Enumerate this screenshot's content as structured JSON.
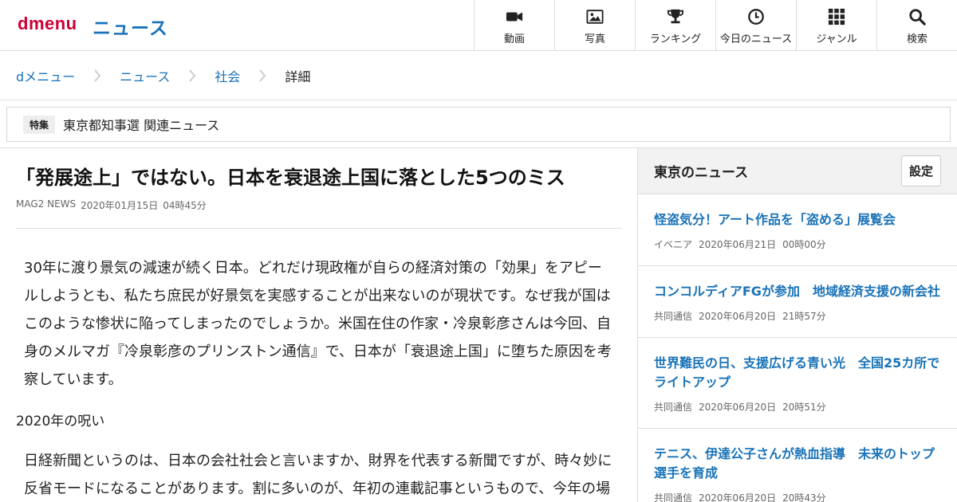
{
  "header": {
    "logo": "dmenu",
    "section": "ニュース",
    "nav": [
      {
        "label": "動画",
        "icon": "video-camera-icon"
      },
      {
        "label": "写真",
        "icon": "photo-icon"
      },
      {
        "label": "ランキング",
        "icon": "trophy-icon"
      },
      {
        "label": "今日のニュース",
        "icon": "clock-icon"
      },
      {
        "label": "ジャンル",
        "icon": "grid-icon"
      },
      {
        "label": "検索",
        "icon": "search-icon"
      }
    ]
  },
  "breadcrumb": [
    "dメニュー",
    "ニュース",
    "社会",
    "詳細"
  ],
  "feature": {
    "badge": "特集",
    "link": "東京都知事選 関連ニュース"
  },
  "article": {
    "title": "「発展途上」ではない。日本を衰退途上国に落とした5つのミス",
    "source": "MAG2 NEWS",
    "date": "2020年01月15日",
    "time": "04時45分",
    "lead": "30年に渡り景気の減速が続く日本。どれだけ現政権が自らの経済対策の「効果」をアピールしようとも、私たち庶民が好景気を実感することが出来ないのが現状です。なぜ我が国はこのような惨状に陥ってしまったのでしょうか。米国在住の作家・冷泉彰彦さんは今回、自身のメルマガ『冷泉彰彦のプリンストン通信』で、日本が「衰退途上国」に堕ちた原因を考察しています。",
    "subhead": "2020年の呪い",
    "body": "日経新聞というのは、日本の会社社会と言いますか、財界を代表する新聞ですが、時々妙に反省モードになることがあります。割に多いのが、年初の連載記事というもので、今年の場"
  },
  "sidebar": {
    "title": "東京のニュース",
    "settings_label": "設定",
    "items": [
      {
        "title": "怪盗気分！アート作品を「盗める」展覧会",
        "source": "イベニア",
        "date": "2020年06月21日",
        "time": "00時00分"
      },
      {
        "title": "コンコルディアFGが参加　地域経済支援の新会社",
        "source": "共同通信",
        "date": "2020年06月20日",
        "time": "21時57分"
      },
      {
        "title": "世界難民の日、支援広げる青い光　全国25カ所でライトアップ",
        "source": "共同通信",
        "date": "2020年06月20日",
        "time": "20時51分"
      },
      {
        "title": "テニス、伊達公子さんが熱血指導　未来のトップ選手を育成",
        "source": "共同通信",
        "date": "2020年06月20日",
        "time": "20時43分"
      }
    ]
  }
}
